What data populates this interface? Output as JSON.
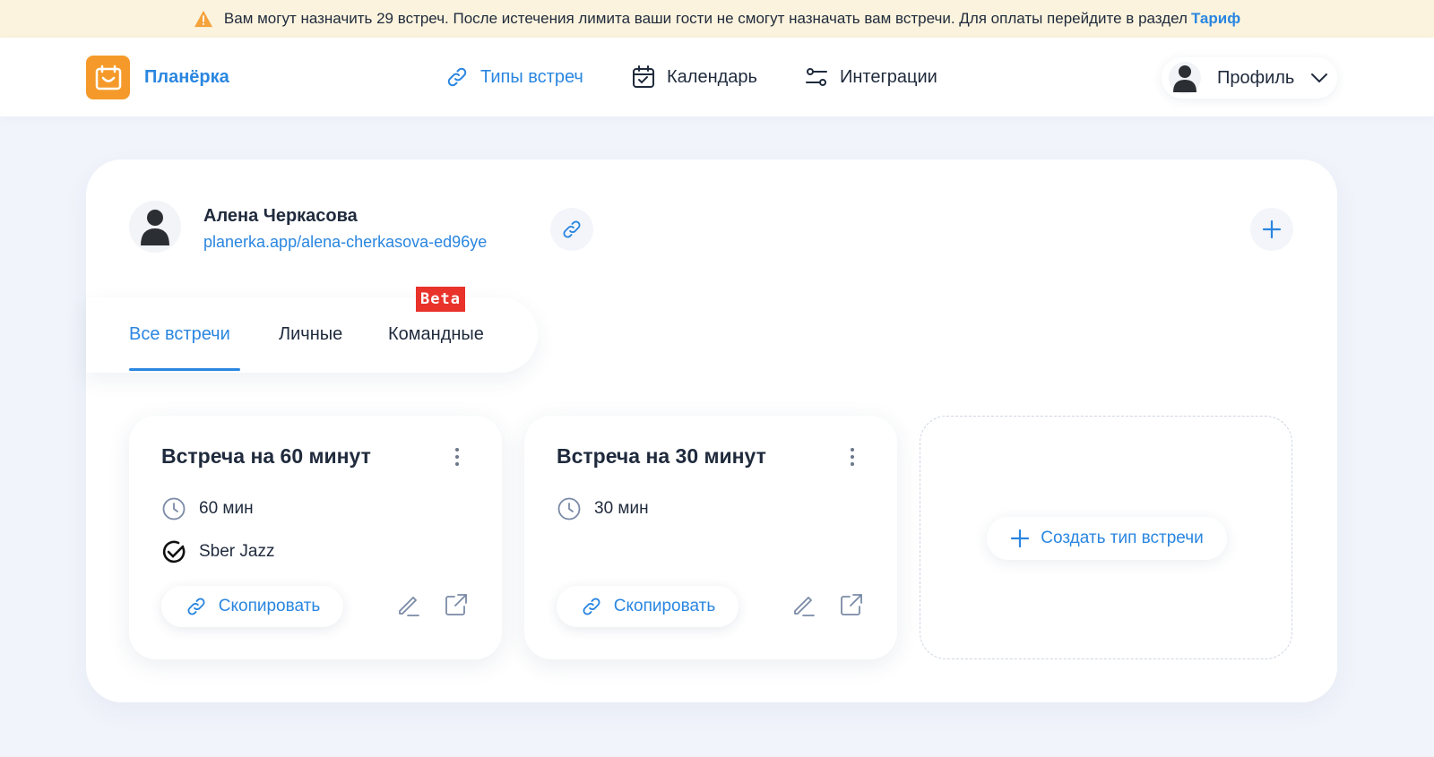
{
  "banner": {
    "text": "Вам могут назначить 29 встреч. После истечения лимита ваши гости не смогут назначать вам встречи. Для оплаты перейдите в раздел",
    "link": "Тариф",
    "icon": "warning-icon"
  },
  "header": {
    "logo_text": "Планёрка",
    "nav": [
      {
        "label": "Типы встреч",
        "icon": "link-icon",
        "active": true
      },
      {
        "label": "Календарь",
        "icon": "calendar-icon",
        "active": false
      },
      {
        "label": "Интеграции",
        "icon": "sliders-icon",
        "active": false
      }
    ],
    "profile_label": "Профиль"
  },
  "user": {
    "name": "Алена Черкасова",
    "link": "planerka.app/alena-cherkasova-ed96ye"
  },
  "tabs": [
    {
      "label": "Все встречи",
      "active": true
    },
    {
      "label": "Личные",
      "active": false
    },
    {
      "label": "Командные",
      "active": false
    }
  ],
  "beta_badge": "Beta",
  "cards": [
    {
      "title": "Встреча на 60 минут",
      "duration": "60 мин",
      "integration": "Sber Jazz",
      "copy_label": "Скопировать"
    },
    {
      "title": "Встреча на 30 минут",
      "duration": "30 мин",
      "copy_label": "Скопировать"
    }
  ],
  "create_label": "Создать тип встречи",
  "colors": {
    "accent": "#2a86e0",
    "logo": "#f59a2a",
    "banner_bg": "#fbf3dd",
    "beta": "#e8322a"
  }
}
